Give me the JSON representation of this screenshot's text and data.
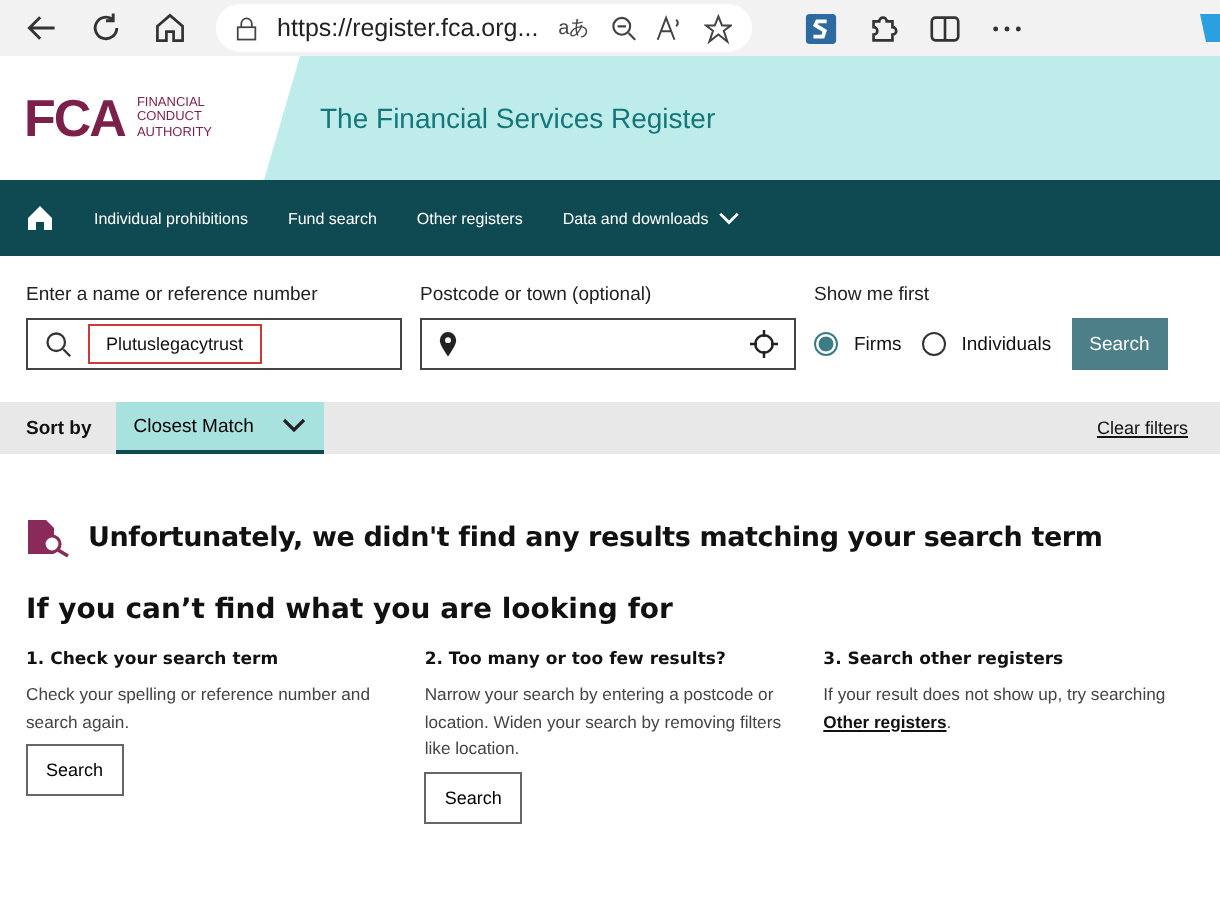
{
  "browser": {
    "url": "https://register.fca.org...",
    "translate_glyph": "aあ"
  },
  "header": {
    "logo": {
      "letters": "FCA",
      "words": [
        "FINANCIAL",
        "CONDUCT",
        "AUTHORITY"
      ]
    },
    "title": "The Financial Services Register"
  },
  "nav": {
    "items": [
      {
        "label": "Individual prohibitions",
        "dropdown": false
      },
      {
        "label": "Fund search",
        "dropdown": false
      },
      {
        "label": "Other registers",
        "dropdown": false
      },
      {
        "label": "Data and downloads",
        "dropdown": true
      }
    ]
  },
  "search": {
    "name_label": "Enter a name or reference number",
    "name_value": "Plutuslegacytrust",
    "postcode_label": "Postcode or town (optional)",
    "show_label": "Show me first",
    "options": [
      {
        "label": "Firms",
        "selected": true
      },
      {
        "label": "Individuals",
        "selected": false
      }
    ],
    "button": "Search"
  },
  "sort": {
    "label": "Sort by",
    "value": "Closest Match",
    "clear": "Clear filters"
  },
  "no_results": "Unfortunately, we didn't find any results matching your search term",
  "help": {
    "title": "If you can’t find what you are looking for",
    "columns": [
      {
        "heading": "1. Check your search term",
        "text": "Check your spelling or reference number and search again.",
        "button": "Search"
      },
      {
        "heading": "2. Too many or too few results?",
        "text": "Narrow your search by entering a postcode or location. Widen your search by removing filters like location.",
        "button": "Search"
      },
      {
        "heading": "3. Search other registers",
        "text": "If your result does not show up, try searching",
        "link": "Other registers",
        "after": "."
      }
    ]
  }
}
